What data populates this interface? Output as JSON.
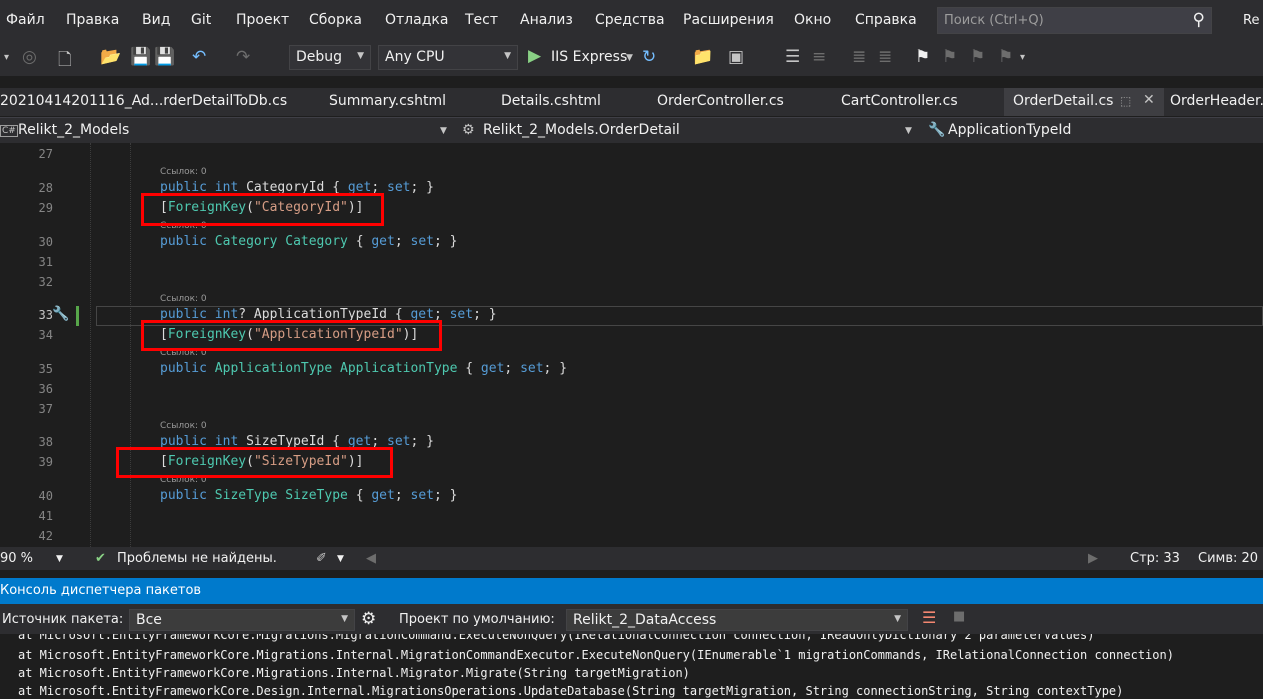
{
  "menu": [
    "Файл",
    "Правка",
    "Вид",
    "Git",
    "Проект",
    "Сборка",
    "Отладка",
    "Тест",
    "Анализ",
    "Средства",
    "Расширения",
    "Окно",
    "Справка"
  ],
  "search": {
    "placeholder": "Поиск (Ctrl+Q)"
  },
  "window_title_fragment": "Re",
  "toolbar": {
    "configuration": "Debug",
    "platform": "Any CPU",
    "run_target": "IIS Express"
  },
  "tabs": [
    {
      "label": "20210414201116_Ad...rderDetailToDb.cs",
      "active": false
    },
    {
      "label": "Summary.cshtml",
      "active": false
    },
    {
      "label": "Details.cshtml",
      "active": false
    },
    {
      "label": "OrderController.cs",
      "active": false
    },
    {
      "label": "CartController.cs",
      "active": false
    },
    {
      "label": "OrderDetail.cs",
      "active": true
    },
    {
      "label": "OrderHeader.cs",
      "active": false
    }
  ],
  "navbar": {
    "project": "Relikt_2_Models",
    "type": "Relikt_2_Models.OrderDetail",
    "member": "ApplicationTypeId",
    "project_badge": "C#"
  },
  "codelens_text": "Ссылок: 0",
  "lines": [
    {
      "n": "27",
      "code": ""
    },
    {
      "n": "28",
      "code": "public int CategoryId { get; set; }"
    },
    {
      "n": "29",
      "code": "[ForeignKey(\"CategoryId\")]"
    },
    {
      "n": "30",
      "code": "public Category Category { get; set; }"
    },
    {
      "n": "31",
      "code": ""
    },
    {
      "n": "32",
      "code": ""
    },
    {
      "n": "33",
      "code": "public int? ApplicationTypeId { get; set; }"
    },
    {
      "n": "34",
      "code": "[ForeignKey(\"ApplicationTypeId\")]"
    },
    {
      "n": "35",
      "code": "public ApplicationType ApplicationType { get; set; }"
    },
    {
      "n": "36",
      "code": ""
    },
    {
      "n": "37",
      "code": ""
    },
    {
      "n": "38",
      "code": "public int SizeTypeId { get; set; }"
    },
    {
      "n": "39",
      "code": "[ForeignKey(\"SizeTypeId\")]"
    },
    {
      "n": "40",
      "code": "public SizeType SizeType { get; set; }"
    },
    {
      "n": "41",
      "code": ""
    },
    {
      "n": "42",
      "code": ""
    }
  ],
  "status": {
    "zoom": "90 %",
    "issues": "Проблемы не найдены.",
    "line": "Стр: 33",
    "col": "Симв: 20"
  },
  "pmc": {
    "title": "Консоль диспетчера пакетов",
    "source_label": "Источник пакета:",
    "source_value": "Все",
    "project_label": "Проект по умолчанию:",
    "project_value": "Relikt_2_DataAccess",
    "output": [
      "at Microsoft.EntityFrameworkCore.Migrations.MigrationCommand.ExecuteNonQuery(IRelationalConnection connection, IReadOnlyDictionary`2 parameterValues)",
      "at Microsoft.EntityFrameworkCore.Migrations.Internal.MigrationCommandExecutor.ExecuteNonQuery(IEnumerable`1 migrationCommands, IRelationalConnection connection)",
      "at Microsoft.EntityFrameworkCore.Migrations.Internal.Migrator.Migrate(String targetMigration)",
      "at Microsoft.EntityFrameworkCore.Design.Internal.MigrationsOperations.UpdateDatabase(String targetMigration, String connectionString, String contextType)"
    ]
  },
  "colors": {
    "keyword": "#569cd6",
    "type": "#4ec9b0",
    "string": "#d69d85",
    "accent": "#007acc",
    "highlight": "#ff0000"
  }
}
